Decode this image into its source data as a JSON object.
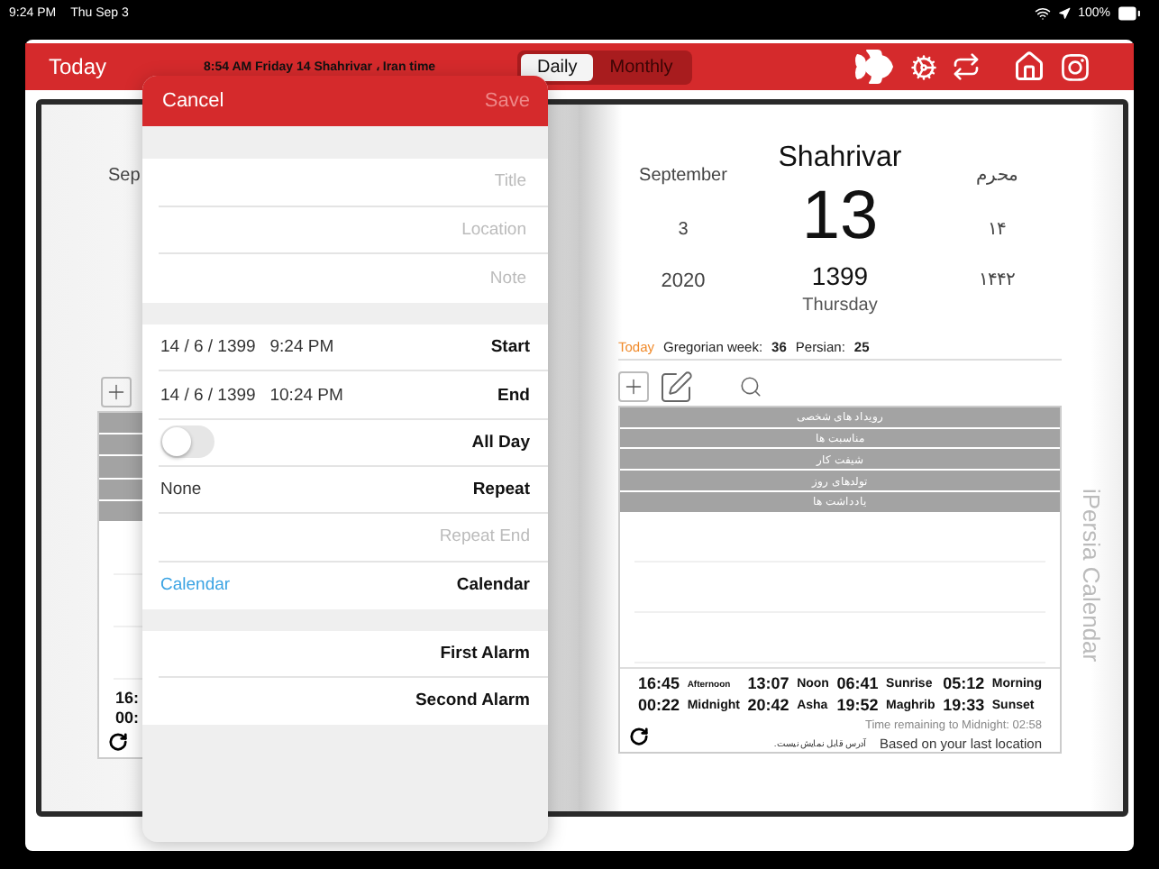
{
  "status_bar": {
    "time": "9:24 PM",
    "date": "Thu Sep 3",
    "battery": "100%"
  },
  "header": {
    "today_button": "Today",
    "clock_text": "8:54 AM  Friday 14 Shahrivar ، Iran time",
    "view_tabs": [
      {
        "label": "Daily",
        "selected": true
      },
      {
        "label": "Monthly",
        "selected": false
      }
    ]
  },
  "left_page": {
    "month_fragment": "Sep",
    "time_fragments": [
      "16:",
      "00:"
    ]
  },
  "right_page": {
    "persian_month": "Shahrivar",
    "gregorian_month": "September",
    "hijri_month": "محرم",
    "persian_day": "13",
    "gregorian_day": "3",
    "hijri_day": "۱۴",
    "persian_year": "1399",
    "gregorian_year": "2020",
    "hijri_year": "۱۴۴۲",
    "weekday": "Thursday",
    "today_link": "Today",
    "week_label": "Gregorian week:",
    "week_value": "36",
    "persian_label": "Persian:",
    "persian_value": "25",
    "categories": [
      "رویداد های شخصی",
      "مناسبت ها",
      "شیفت کار",
      "تولدهای روز",
      "یادداشت ها"
    ],
    "prayer_times": [
      [
        {
          "time": "16:45",
          "name": "Afternoon"
        },
        {
          "time": "13:07",
          "name": "Noon"
        },
        {
          "time": "06:41",
          "name": "Sunrise"
        },
        {
          "time": "05:12",
          "name": "Morning"
        }
      ],
      [
        {
          "time": "00:22",
          "name": "Midnight"
        },
        {
          "time": "20:42",
          "name": "Asha"
        },
        {
          "time": "19:52",
          "name": "Maghrib"
        },
        {
          "time": "19:33",
          "name": "Sunset"
        }
      ]
    ],
    "remaining": "Time remaining to Midnight: 02:58",
    "address": "آدرس قابل نمایش نیست.",
    "location_note": "Based on your last location",
    "brand": "iPersia Calendar"
  },
  "event_form": {
    "cancel": "Cancel",
    "save": {
      "label": "Save",
      "disabled": true
    },
    "fields": [
      {
        "placeholder": "Title"
      },
      {
        "placeholder": "Location"
      },
      {
        "placeholder": "Note"
      }
    ],
    "rows": [
      {
        "kind": "value",
        "value": "14 / 6 / 1399   9:24 PM",
        "label": "Start"
      },
      {
        "kind": "value",
        "value": "14 / 6 / 1399   10:24 PM",
        "label": "End"
      },
      {
        "kind": "switch",
        "label": "All Day",
        "on": false
      },
      {
        "kind": "value",
        "value": "None",
        "label": "Repeat"
      },
      {
        "kind": "placeholder",
        "placeholder": "Repeat End"
      },
      {
        "kind": "link",
        "value": "Calendar",
        "label": "Calendar"
      }
    ],
    "alarms": [
      "First Alarm",
      "Second Alarm"
    ]
  }
}
